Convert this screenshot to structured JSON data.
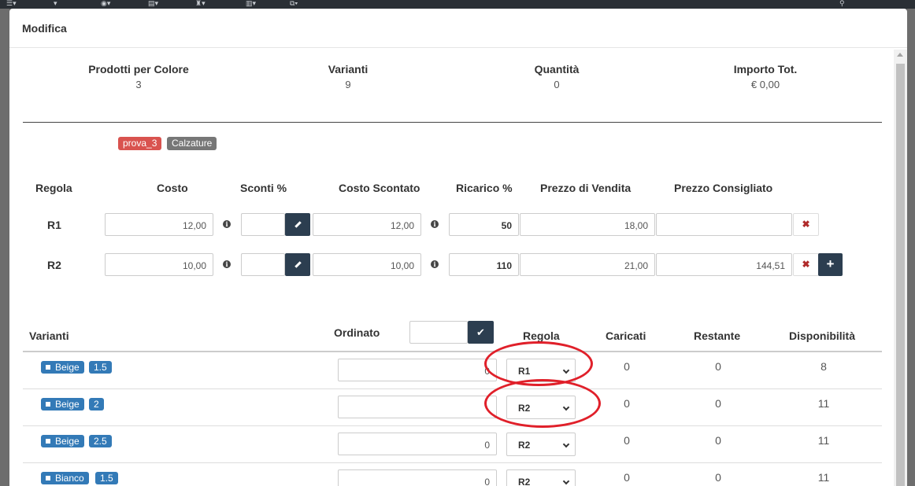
{
  "modal": {
    "title": "Modifica"
  },
  "summary": [
    {
      "label": "Prodotti per Colore",
      "value": "3"
    },
    {
      "label": "Varianti",
      "value": "9"
    },
    {
      "label": "Quantità",
      "value": "0"
    },
    {
      "label": "Importo Tot.",
      "value": "€ 0,00"
    }
  ],
  "tags": [
    "prova_3",
    "Calzature"
  ],
  "rules_table": {
    "headers": [
      "Regola",
      "Costo",
      "Sconti %",
      "Costo Scontato",
      "Ricarico %",
      "Prezzo di Vendita",
      "Prezzo Consigliato"
    ],
    "rows": [
      {
        "name": "R1",
        "costo": "12,00",
        "sconti": "",
        "costo_scontato": "12,00",
        "ricarico": "50",
        "prezzo_vendita": "18,00",
        "prezzo_consigliato": ""
      },
      {
        "name": "R2",
        "costo": "10,00",
        "sconti": "",
        "costo_scontato": "10,00",
        "ricarico": "110",
        "prezzo_vendita": "21,00",
        "prezzo_consigliato": "144,51"
      }
    ]
  },
  "variants_table": {
    "headers": {
      "varianti": "Varianti",
      "ordinato": "Ordinato",
      "regola": "Regola",
      "caricati": "Caricati",
      "restante": "Restante",
      "disponibilita": "Disponibilità"
    },
    "ordinato_input": "",
    "rows": [
      {
        "color": "Beige",
        "size": "1.5",
        "ordinato": "0",
        "regola": "R1",
        "caricati": "0",
        "restante": "0",
        "disponibilita": "8"
      },
      {
        "color": "Beige",
        "size": "2",
        "ordinato": "",
        "regola": "R2",
        "caricati": "0",
        "restante": "0",
        "disponibilita": "11"
      },
      {
        "color": "Beige",
        "size": "2.5",
        "ordinato": "0",
        "regola": "R2",
        "caricati": "0",
        "restante": "0",
        "disponibilita": "11"
      },
      {
        "color": "Bianco",
        "size": "1.5",
        "ordinato": "0",
        "regola": "R2",
        "caricati": "0",
        "restante": "0",
        "disponibilita": "11"
      }
    ]
  },
  "icons": [
    "menu-icon",
    "eye-icon",
    "file-icon",
    "user-icon",
    "columns-icon",
    "share-icon",
    "search-icon",
    "info-icon",
    "pencil-icon",
    "close-icon",
    "plus-icon",
    "check-icon",
    "chevron-down-icon"
  ],
  "colors": {
    "dark_button": "#2c3e50",
    "badge_blue": "#337ab7",
    "tag_red": "#d9534f",
    "tag_gray": "#777777",
    "highlight_ellipse": "#e0202a"
  }
}
